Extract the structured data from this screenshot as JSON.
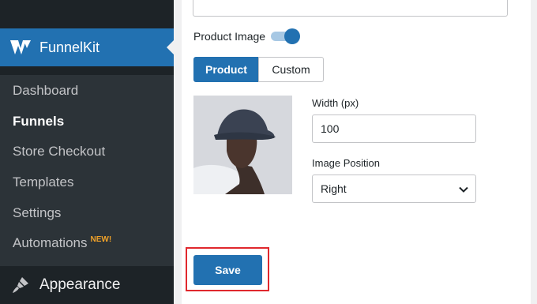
{
  "sidebar": {
    "brand": "FunnelKit",
    "items": [
      {
        "label": "Dashboard"
      },
      {
        "label": "Funnels"
      },
      {
        "label": "Store Checkout"
      },
      {
        "label": "Templates"
      },
      {
        "label": "Settings"
      },
      {
        "label": "Automations",
        "badge": "NEW!"
      }
    ],
    "appearance": "Appearance"
  },
  "settings": {
    "product_image_label": "Product Image",
    "product_image_enabled": true,
    "segments": [
      "Product",
      "Custom"
    ],
    "selected_segment": "Product",
    "width_label": "Width (px)",
    "width_value": "100",
    "position_label": "Image Position",
    "position_value": "Right",
    "save_label": "Save"
  },
  "colors": {
    "accent": "#2271b1",
    "sidebar_bg": "#1d2327",
    "highlight": "#e0282d",
    "badge": "#f0a229"
  }
}
